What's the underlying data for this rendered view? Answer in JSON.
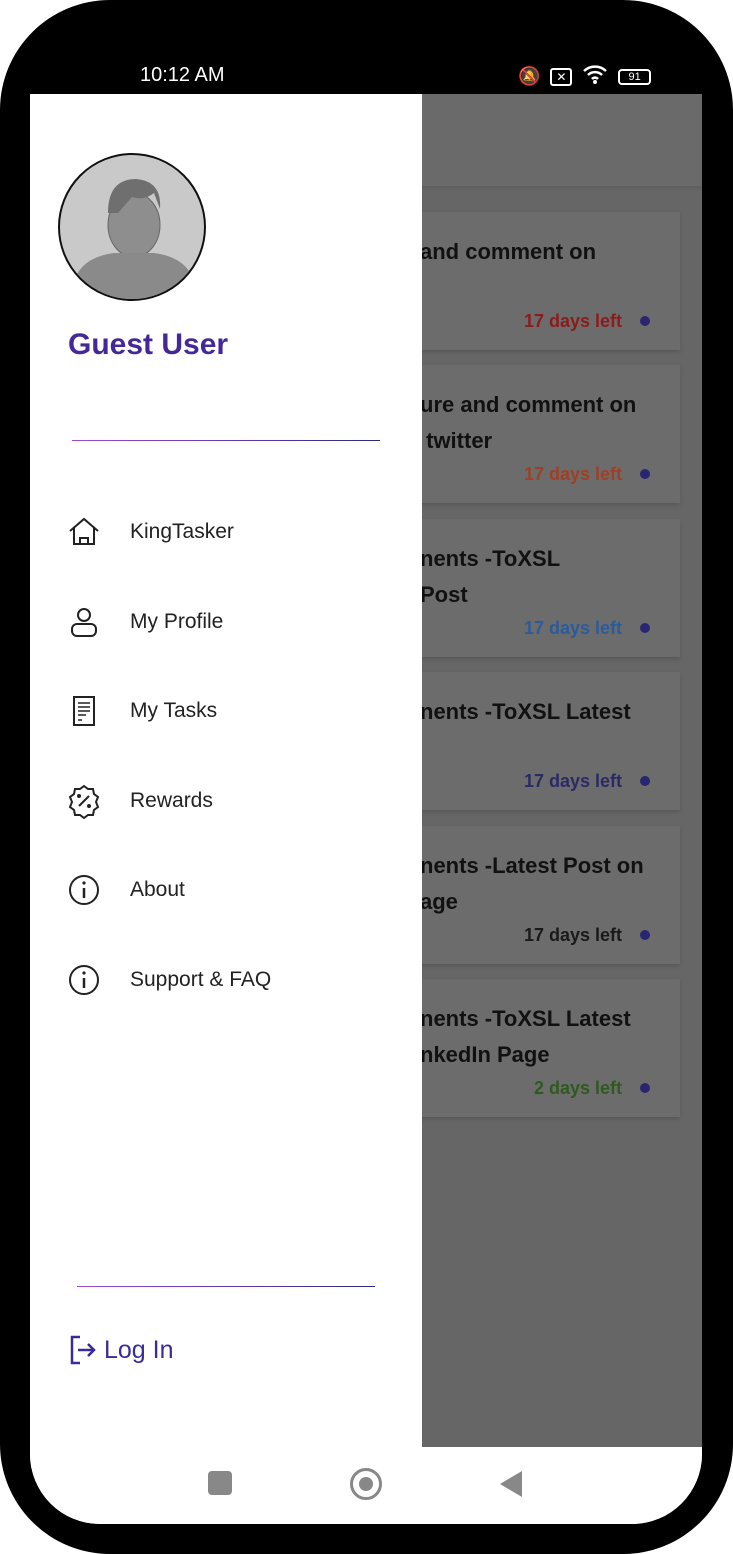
{
  "status": {
    "time": "10:12 AM",
    "battery": "91",
    "icons": [
      "mute-icon",
      "no-sim-icon",
      "wifi-icon",
      "battery-icon"
    ]
  },
  "drawer": {
    "user_name": "Guest User",
    "items": [
      {
        "label": "KingTasker",
        "icon": "home-icon"
      },
      {
        "label": "My Profile",
        "icon": "user-icon"
      },
      {
        "label": "My Tasks",
        "icon": "document-icon"
      },
      {
        "label": "Rewards",
        "icon": "percent-badge-icon"
      },
      {
        "label": "About",
        "icon": "info-icon"
      },
      {
        "label": "Support & FAQ",
        "icon": "info-icon"
      }
    ],
    "login_label": "Log In"
  },
  "tasks": [
    {
      "title": "and comment on",
      "days": "17 days left",
      "color": "#8e1b1b"
    },
    {
      "title": "ure and comment on\n twitter",
      "days": "17 days left",
      "color": "#9e4026"
    },
    {
      "title": "nents -ToXSL\nPost",
      "days": "17 days left",
      "color": "#2c5b9c"
    },
    {
      "title": "nents -ToXSL Latest",
      "days": "17 days left",
      "color": "#2a2a66"
    },
    {
      "title": "nents -Latest Post on\nage",
      "days": "17 days left",
      "color": "#1a1a1a"
    },
    {
      "title": "nents -ToXSL Latest\nnkedIn Page",
      "days": "2 days left",
      "color": "#2f5a1f"
    }
  ],
  "accent": "#44289a"
}
